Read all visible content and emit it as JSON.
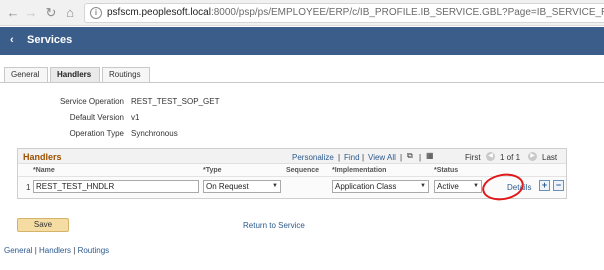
{
  "browser": {
    "url_host": "psfscm.peoplesoft.local",
    "url_rest": ":8000/psp/ps/EMPLOYEE/ERP/c/IB_PROFILE.IB_SERVICE.GBL?Page=IB_SERVICE_REST&Action=A",
    "icons": [
      "back-arrow-icon",
      "forward-arrow-icon",
      "reload-icon",
      "home-icon",
      "info-icon"
    ]
  },
  "banner": {
    "back_glyph": "‹",
    "title": "Services"
  },
  "tabs": [
    {
      "label": "General",
      "active": false
    },
    {
      "label": "Handlers",
      "active": true
    },
    {
      "label": "Routings",
      "active": false
    }
  ],
  "fields": {
    "service_operation_label": "Service Operation",
    "service_operation_value": "REST_TEST_SOP_GET",
    "default_version_label": "Default Version",
    "default_version_value": "v1",
    "operation_type_label": "Operation Type",
    "operation_type_value": "Synchronous"
  },
  "grid": {
    "title": "Handlers",
    "personalize": "Personalize",
    "find": "Find",
    "view_all": "View All",
    "first": "First",
    "range": "1 of 1",
    "last": "Last",
    "columns": {
      "name": "*Name",
      "type": "*Type",
      "sequence": "Sequence",
      "implementation": "*Implementation",
      "status": "*Status"
    },
    "rows": [
      {
        "num": "1",
        "name": "REST_TEST_HNDLR",
        "type": "On Request",
        "implementation": "Application Class",
        "status": "Active",
        "details": "Details"
      }
    ],
    "add_glyph": "+",
    "remove_glyph": "−"
  },
  "actions": {
    "save": "Save",
    "return_to_service": "Return to Service"
  },
  "footer": {
    "general": "General",
    "handlers": "Handlers",
    "routings": "Routings"
  },
  "colors": {
    "banner": "#3b5d89",
    "link": "#2d5a8e",
    "grid_title": "#9d4f00",
    "annotation": "#e0181a"
  }
}
